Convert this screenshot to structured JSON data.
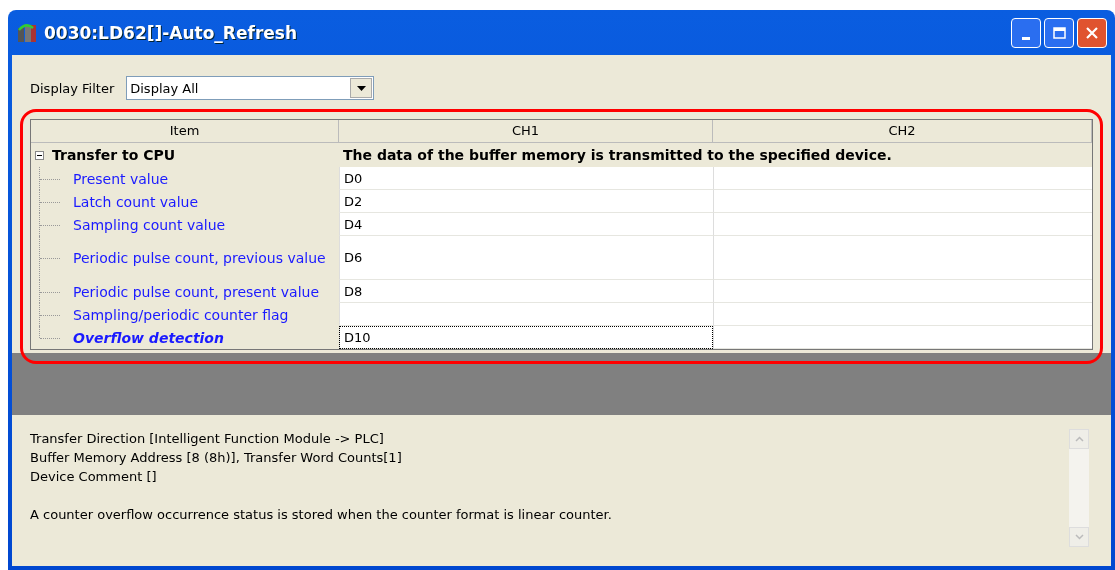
{
  "window": {
    "title": "0030:LD62[]-Auto_Refresh"
  },
  "filter": {
    "label": "Display Filter",
    "value": "Display All"
  },
  "table": {
    "columns": [
      "Item",
      "CH1",
      "CH2"
    ],
    "group": {
      "label": "Transfer to CPU",
      "expanded": true,
      "description": "The data of the buffer memory is transmitted to the specified device."
    },
    "rows": [
      {
        "item": "Present value",
        "ch1": "D0",
        "selected": false
      },
      {
        "item": "Latch count value",
        "ch1": "D2",
        "selected": false
      },
      {
        "item": "Sampling count value",
        "ch1": "D4",
        "selected": false
      },
      {
        "item": "Periodic pulse count, previous value",
        "ch1": "D6",
        "selected": false
      },
      {
        "item": "Periodic pulse count, present value",
        "ch1": "D8",
        "selected": false
      },
      {
        "item": "Sampling/periodic counter flag",
        "selected": false
      },
      {
        "item": "Overflow detection",
        "ch1": "D10",
        "selected": true
      }
    ]
  },
  "details": [
    "Transfer Direction [Intelligent Function Module -> PLC]",
    "Buffer Memory Address [8 (8h)], Transfer Word Counts[1]",
    "Device Comment []",
    "A counter overflow occurrence status is stored when the counter format is linear counter."
  ]
}
